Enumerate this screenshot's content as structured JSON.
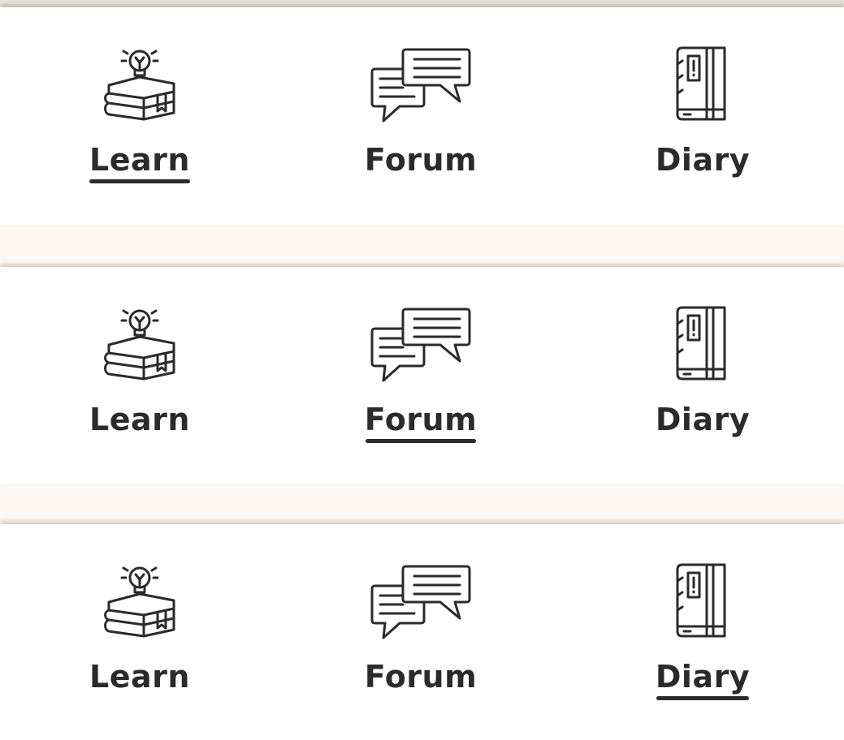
{
  "colors": {
    "background": "#fdf8f3",
    "panel": "#ffffff",
    "text": "#2b2b2b",
    "active_underline": "#2b2b2b"
  },
  "tab_bars": [
    {
      "active_tab": "Learn",
      "tabs": [
        {
          "label": "Learn",
          "icon": "book-stack-lightbulb-icon"
        },
        {
          "label": "Forum",
          "icon": "chat-bubbles-icon"
        },
        {
          "label": "Diary",
          "icon": "notebook-icon"
        }
      ]
    },
    {
      "active_tab": "Forum",
      "tabs": [
        {
          "label": "Learn",
          "icon": "book-stack-lightbulb-icon"
        },
        {
          "label": "Forum",
          "icon": "chat-bubbles-icon"
        },
        {
          "label": "Diary",
          "icon": "notebook-icon"
        }
      ]
    },
    {
      "active_tab": "Diary",
      "tabs": [
        {
          "label": "Learn",
          "icon": "book-stack-lightbulb-icon"
        },
        {
          "label": "Forum",
          "icon": "chat-bubbles-icon"
        },
        {
          "label": "Diary",
          "icon": "notebook-icon"
        }
      ]
    }
  ]
}
